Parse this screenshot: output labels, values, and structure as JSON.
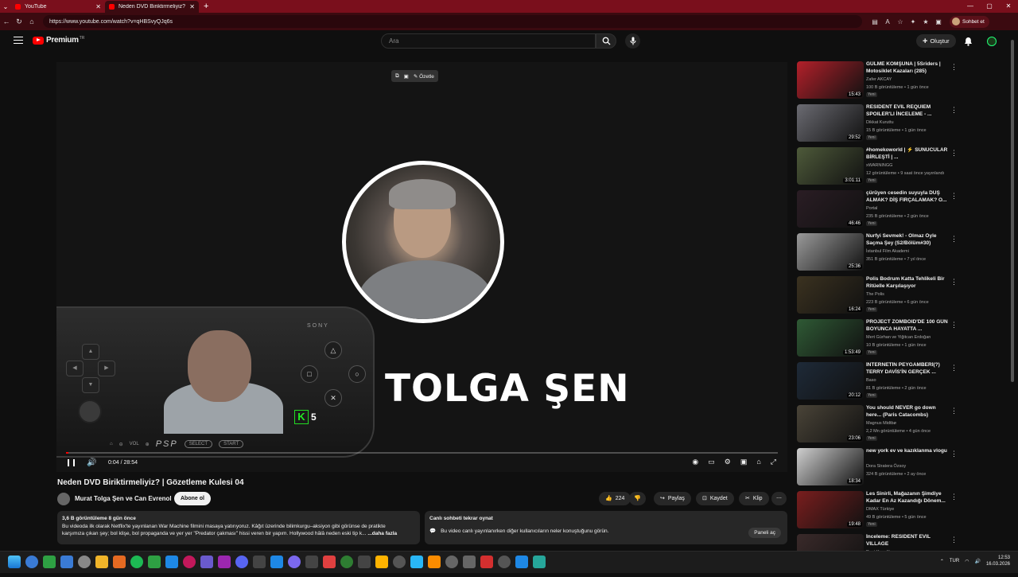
{
  "browser": {
    "tabs": [
      {
        "title": "YouTube"
      },
      {
        "title": "Neden DVD Biriktirmeliyiz? | G"
      }
    ],
    "url": "https://www.youtube.com/watch?v=qHBSvyQJq6s",
    "profile_label": "Sohbet et"
  },
  "header": {
    "logo_text": "Premium",
    "logo_country": "TR",
    "search_placeholder": "Ara",
    "create_label": "Oluştur"
  },
  "player": {
    "toolbar_label": "Özetle",
    "overlay_name": "TOLGA ŞEN",
    "psp_brand": "SONY",
    "psp_logo": "PSP",
    "psp_vol": "VOL",
    "psp_select": "SELECT",
    "psp_start": "START",
    "channel_badge": "5",
    "time": "0:04 / 28:54",
    "progress_fraction": 0.003
  },
  "video": {
    "title": "Neden DVD Biriktirmeliyiz? | Gözetleme Kulesi 04",
    "channel": "Murat Tolga Şen ve Can Evrenol",
    "subscribe": "Abone ol",
    "likes": "224",
    "share": "Paylaş",
    "save": "Kaydet",
    "clip": "Klip"
  },
  "description": {
    "meta": "3,6 B görüntüleme  8 gün önce",
    "line1": "Bu videoda ilk olarak Netflix'te yayınlanan War Machine filmini masaya yatırıyoruz. Kâğıt üzerinde bilimkurgu–aksiyon gibi görünse de pratikte",
    "line2": "karşımıza çıkan şey; bol klişe, bol propaganda ve yer yer \"Predator çakması\" hissi veren bir yapım. Hollywood hâlâ neden eski tip k...",
    "more": "...daha fazla"
  },
  "chat": {
    "title": "Canlı sohbeti tekrar oynat",
    "message": "Bu video canlı yayınlanırken diğer kullanıcıların neler konuştuğunu görün.",
    "button": "Paneli aç"
  },
  "recommendations": [
    {
      "title": "GÜLME KOMŞUNA | 5Sriders | Motosiklet Kazaları (285)",
      "channel": "Zafer AKCAY",
      "views": "100 B görüntüleme • 1 gün önce",
      "badge": "Yeni",
      "duration": "15:43",
      "color": "#b3202a"
    },
    {
      "title": "RESIDENT EVIL REQUIEM SPOILER'LI İNCELEME - ...",
      "channel": "Dikkat Kuruttu",
      "views": "15 B görüntüleme • 1 gün önce",
      "badge": "Yeni",
      "duration": "29:52",
      "color": "#6b6b72"
    },
    {
      "title": "#homekoworld | ⚡ SUNUCULAR BİRLEŞTİ | ...",
      "channel": "xWARNINGG",
      "views": "12 görüntüleme • 9 saat önce yayınlandı",
      "badge": "Yeni",
      "duration": "3:01:11",
      "color": "#4e5a3a"
    },
    {
      "title": "çürüyen cesedin suyuyla DUŞ ALMAK? DİŞ FIRÇALAMAK? O...",
      "channel": "Portal",
      "views": "235 B görüntüleme • 2 gün önce",
      "badge": "Yeni",
      "duration": "46:46",
      "color": "#2a1d24"
    },
    {
      "title": "Nurfyi Sevmek! - Olmaz Öyle Saçma Şey (S2/Bölüm#30)",
      "channel": "İstanbul Film Akademi",
      "views": "351 B görüntüleme • 7 yıl önce",
      "badge": "",
      "duration": "25:36",
      "color": "#9a9a9a"
    },
    {
      "title": "Polis Bodrum Katta Tehlikeli Bir Ritüelle Karşılaşıyor",
      "channel": "The Polis",
      "views": "223 B görüntüleme • 6 gün önce",
      "badge": "Yeni",
      "duration": "16:24",
      "color": "#3b3220"
    },
    {
      "title": "PROJECT ZOMBOID'DE 100 GÜN BOYUNCA HAYATTA ...",
      "channel": "Mert Gürhan ve Yiğitcan Erdoğan",
      "views": "10 B görüntüleme • 1 gün önce",
      "badge": "Yeni",
      "duration": "1:53:49",
      "color": "#2f5a35"
    },
    {
      "title": "İNTERNETİN PEYGAMBERİ(?) TERRY DAVİS'İN GERÇEK ...",
      "channel": "Baso",
      "views": "81 B görüntüleme • 2 gün önce",
      "badge": "Yeni",
      "duration": "20:12",
      "color": "#1e2a38"
    },
    {
      "title": "You should NEVER go down here... (Paris Catacombs)",
      "channel": "Magnus Midtbø",
      "views": "2,2 Mn görüntüleme • 4 gün önce",
      "badge": "Yeni",
      "duration": "23:06",
      "color": "#4a4438"
    },
    {
      "title": "new york ev ve kazıklanma vlogu",
      "channel": "Dora Stratera Özsoy",
      "views": "324 B görüntüleme • 2 ay önce",
      "badge": "",
      "duration": "18:34",
      "color": "#cfcfcf"
    },
    {
      "title": "Les Sinirli, Mağazanın Şimdiye Kadar En Az Kazandığı Dönem...",
      "channel": "DMAX Türkiye",
      "views": "49 B görüntüleme • 5 gün önce",
      "badge": "Yeni",
      "duration": "19:48",
      "color": "#7a1e1e"
    },
    {
      "title": "İnceleme: RESIDENT EVIL VILLAGE",
      "channel": "Dost Kayoğlu",
      "views": "",
      "badge": "",
      "duration": "",
      "color": "#3a2a2a"
    }
  ],
  "taskbar": {
    "lang": "TUR",
    "time": "12:53",
    "date": "16.03.2026",
    "app_colors": [
      "#3a7bd5",
      "#2ea043",
      "#3a7bd5",
      "#888",
      "#f0b429",
      "#e66a22",
      "#1db954",
      "#2ea043",
      "#1e88e5",
      "#c2185b",
      "#6a5acd",
      "#9c27b0",
      "#5865f2",
      "#444",
      "#1e88e5",
      "#7b68ee",
      "#444",
      "#e04040",
      "#2e7d32",
      "#444",
      "#ffb300",
      "#555",
      "#29b6f6",
      "#fb8c00",
      "#666",
      "#666",
      "#d32f2f",
      "#555",
      "#1e88e5",
      "#26a69a"
    ]
  }
}
